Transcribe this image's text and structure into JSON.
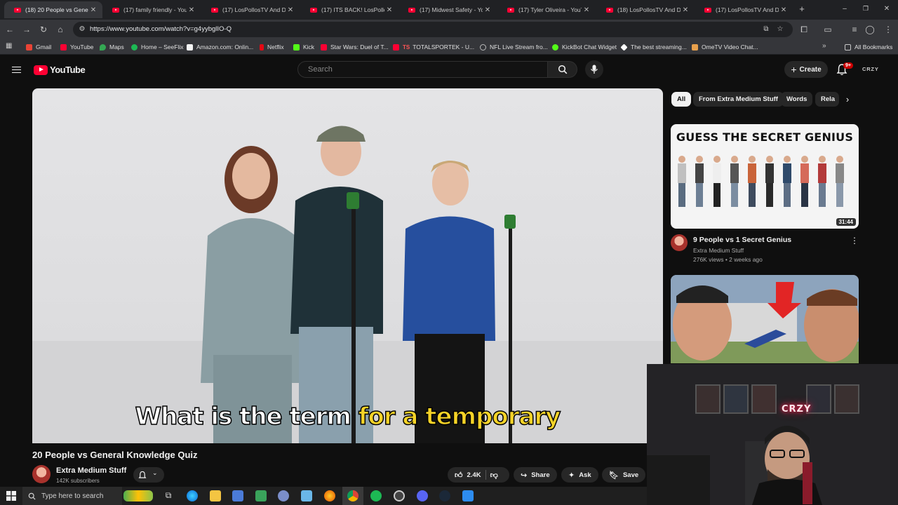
{
  "browser": {
    "tabs": [
      {
        "title": "(18) 20 People vs General",
        "active": true
      },
      {
        "title": "(17) family friendly - YouT",
        "active": false
      },
      {
        "title": "(17) LosPollosTV And Dad",
        "active": false
      },
      {
        "title": "(17) ITS BACK! LosPollosTV",
        "active": false
      },
      {
        "title": "(17) Midwest Safety - YouT",
        "active": false
      },
      {
        "title": "(17) Tyler Oliveira - YouTub",
        "active": false
      },
      {
        "title": "(18) LosPollosTV And Dad",
        "active": false
      },
      {
        "title": "(17) LosPollosTV And Dad",
        "active": false
      }
    ],
    "url": "https://www.youtube.com/watch?v=g4yybglIO-Q",
    "bookmarks": [
      {
        "label": "Gmail",
        "color": "#ea4335"
      },
      {
        "label": "YouTube",
        "color": "#ff0033"
      },
      {
        "label": "Maps",
        "color": "#34a853"
      },
      {
        "label": "Home – SeeFlix",
        "color": "#1db954"
      },
      {
        "label": "Amazon.com: Onlin...",
        "color": "#f5f5f5"
      },
      {
        "label": "Netflix",
        "color": "#e50914"
      },
      {
        "label": "Kick",
        "color": "#53fc18"
      },
      {
        "label": "Star Wars: Duel of T...",
        "color": "#ff0033"
      },
      {
        "label": "TOTALSPORTEK - U...",
        "color": "#ff0033"
      },
      {
        "label": "NFL Live Stream fro...",
        "color": "#bbbbbb"
      },
      {
        "label": "KickBot Chat Widget",
        "color": "#53fc18"
      },
      {
        "label": "The best streaming...",
        "color": "#ffffff"
      },
      {
        "label": "OmeTV Video Chat...",
        "color": "#e8a04c"
      }
    ],
    "all_bookmarks_label": "All Bookmarks"
  },
  "header": {
    "logo_text": "YouTube",
    "search_placeholder": "Search",
    "create_label": "Create",
    "notification_count": "9+",
    "account_label": "CRZY"
  },
  "video": {
    "caption_white": "What is the term ",
    "caption_highlight": "for a temporary",
    "title": "20 People vs General Knowledge Quiz",
    "channel_name": "Extra Medium Stuff",
    "subscribers": "142K subscribers",
    "like_count": "2.4K",
    "share_label": "Share",
    "ask_label": "Ask",
    "save_label": "Save"
  },
  "chips": [
    "All",
    "From Extra Medium Stuff",
    "Words",
    "Rela"
  ],
  "recommendations": [
    {
      "thumb_heading": "GUESS THE SECRET GENIUS",
      "duration": "31:44",
      "title": "9 People vs 1 Secret Genius",
      "channel": "Extra Medium Stuff",
      "meta": "276K views • 2 weeks ago"
    }
  ],
  "webcam": {
    "sign_text": "CRZY"
  },
  "taskbar": {
    "search_placeholder": "Type here to search"
  },
  "colors": {
    "accent": "#ff0033",
    "caption_highlight": "#f5d327",
    "background": "#0f0f0f"
  }
}
